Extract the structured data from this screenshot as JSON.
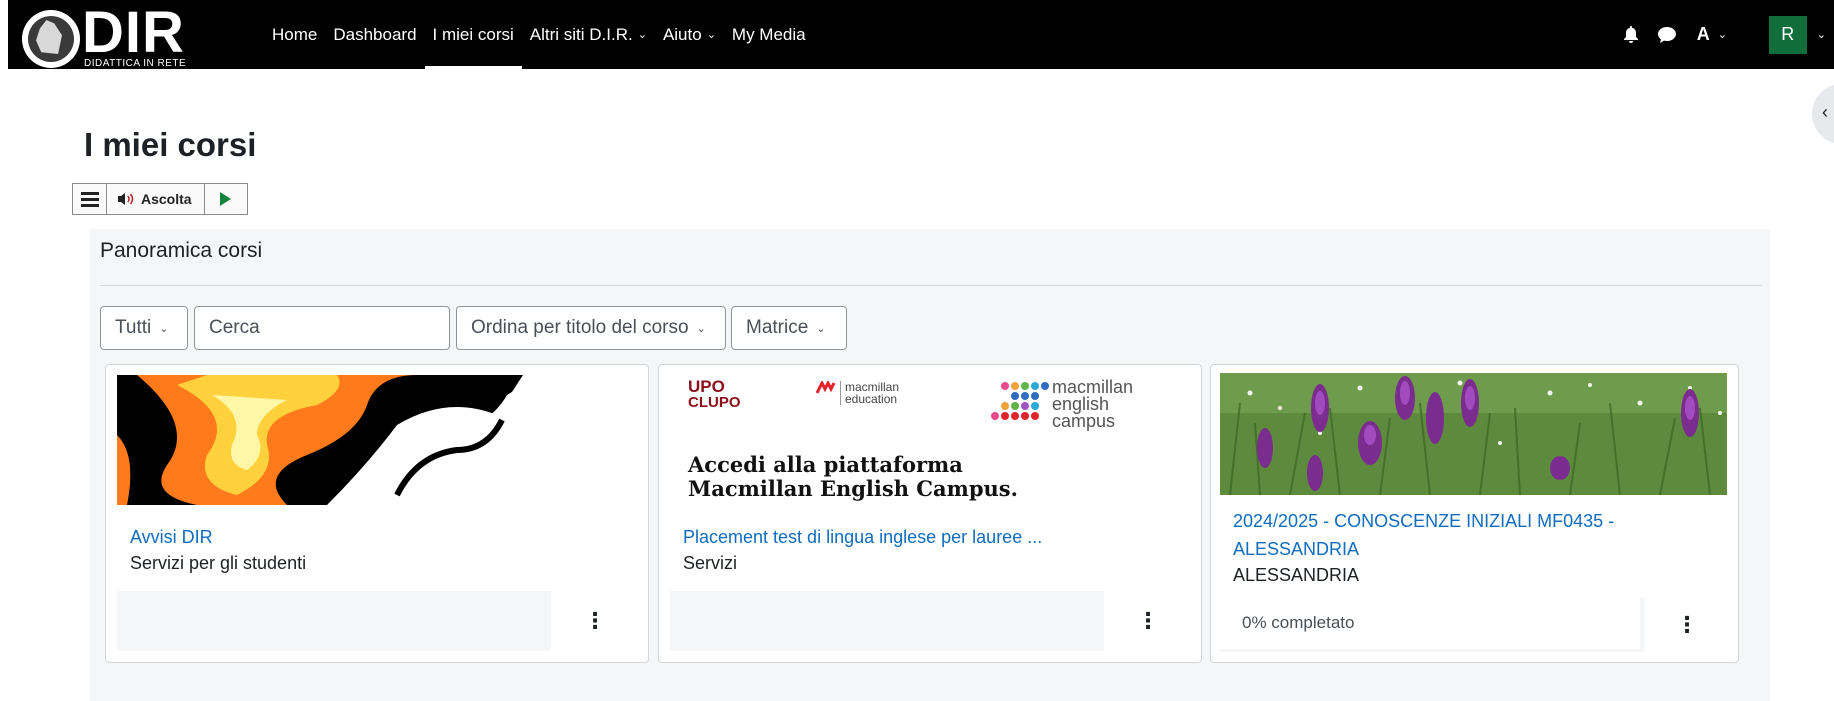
{
  "navbar": {
    "logo_text": "DIR",
    "logo_subtitle": "DIDATTICA IN RETE",
    "menu": [
      {
        "label": "Home",
        "dropdown": false
      },
      {
        "label": "Dashboard",
        "dropdown": false
      },
      {
        "label": "I miei corsi",
        "dropdown": false,
        "active": true
      },
      {
        "label": "Altri siti D.I.R.",
        "dropdown": true
      },
      {
        "label": "Aiuto",
        "dropdown": true
      },
      {
        "label": "My Media",
        "dropdown": false
      }
    ],
    "icons": [
      "bell-icon",
      "chat-icon"
    ],
    "language": "A",
    "user_initial": "R"
  },
  "page": {
    "title": "I miei corsi"
  },
  "readspeaker": {
    "listen_label": "Ascolta"
  },
  "course_overview": {
    "title": "Panoramica corsi",
    "filter": "Tutti",
    "search_placeholder": "Cerca",
    "sort": "Ordina per titolo del corso",
    "view": "Matrice",
    "courses": [
      {
        "name": "Avvisi DIR",
        "category": "Servizi per gli studenti",
        "image": "abstract-yellow-orange"
      },
      {
        "name": "Placement test di lingua inglese per lauree ...",
        "category": "Servizi",
        "image": "macmillan-banner",
        "image_text": {
          "upo_line1": "UPO",
          "upo_line2": "CLUPO",
          "macmillan_education_1": "macmillan",
          "macmillan_education_2": "education",
          "campus_1": "macmillan",
          "campus_2": "english",
          "campus_3": "campus",
          "headline_1": "Accedi alla piattaforma",
          "headline_2": "Macmillan English Campus."
        }
      },
      {
        "name_line1": "2024/2025 - CONOSCENZE INIZIALI MF0435 -",
        "name_line2": "ALESSANDRIA",
        "category": "ALESSANDRIA",
        "progress_label": "0% completato",
        "progress": 0,
        "image": "purple-orchids-meadow"
      }
    ]
  },
  "colors": {
    "navbar": "#000000",
    "link": "#0f6cbf",
    "avatar": "#0f6e3b",
    "play": "#16833d"
  }
}
